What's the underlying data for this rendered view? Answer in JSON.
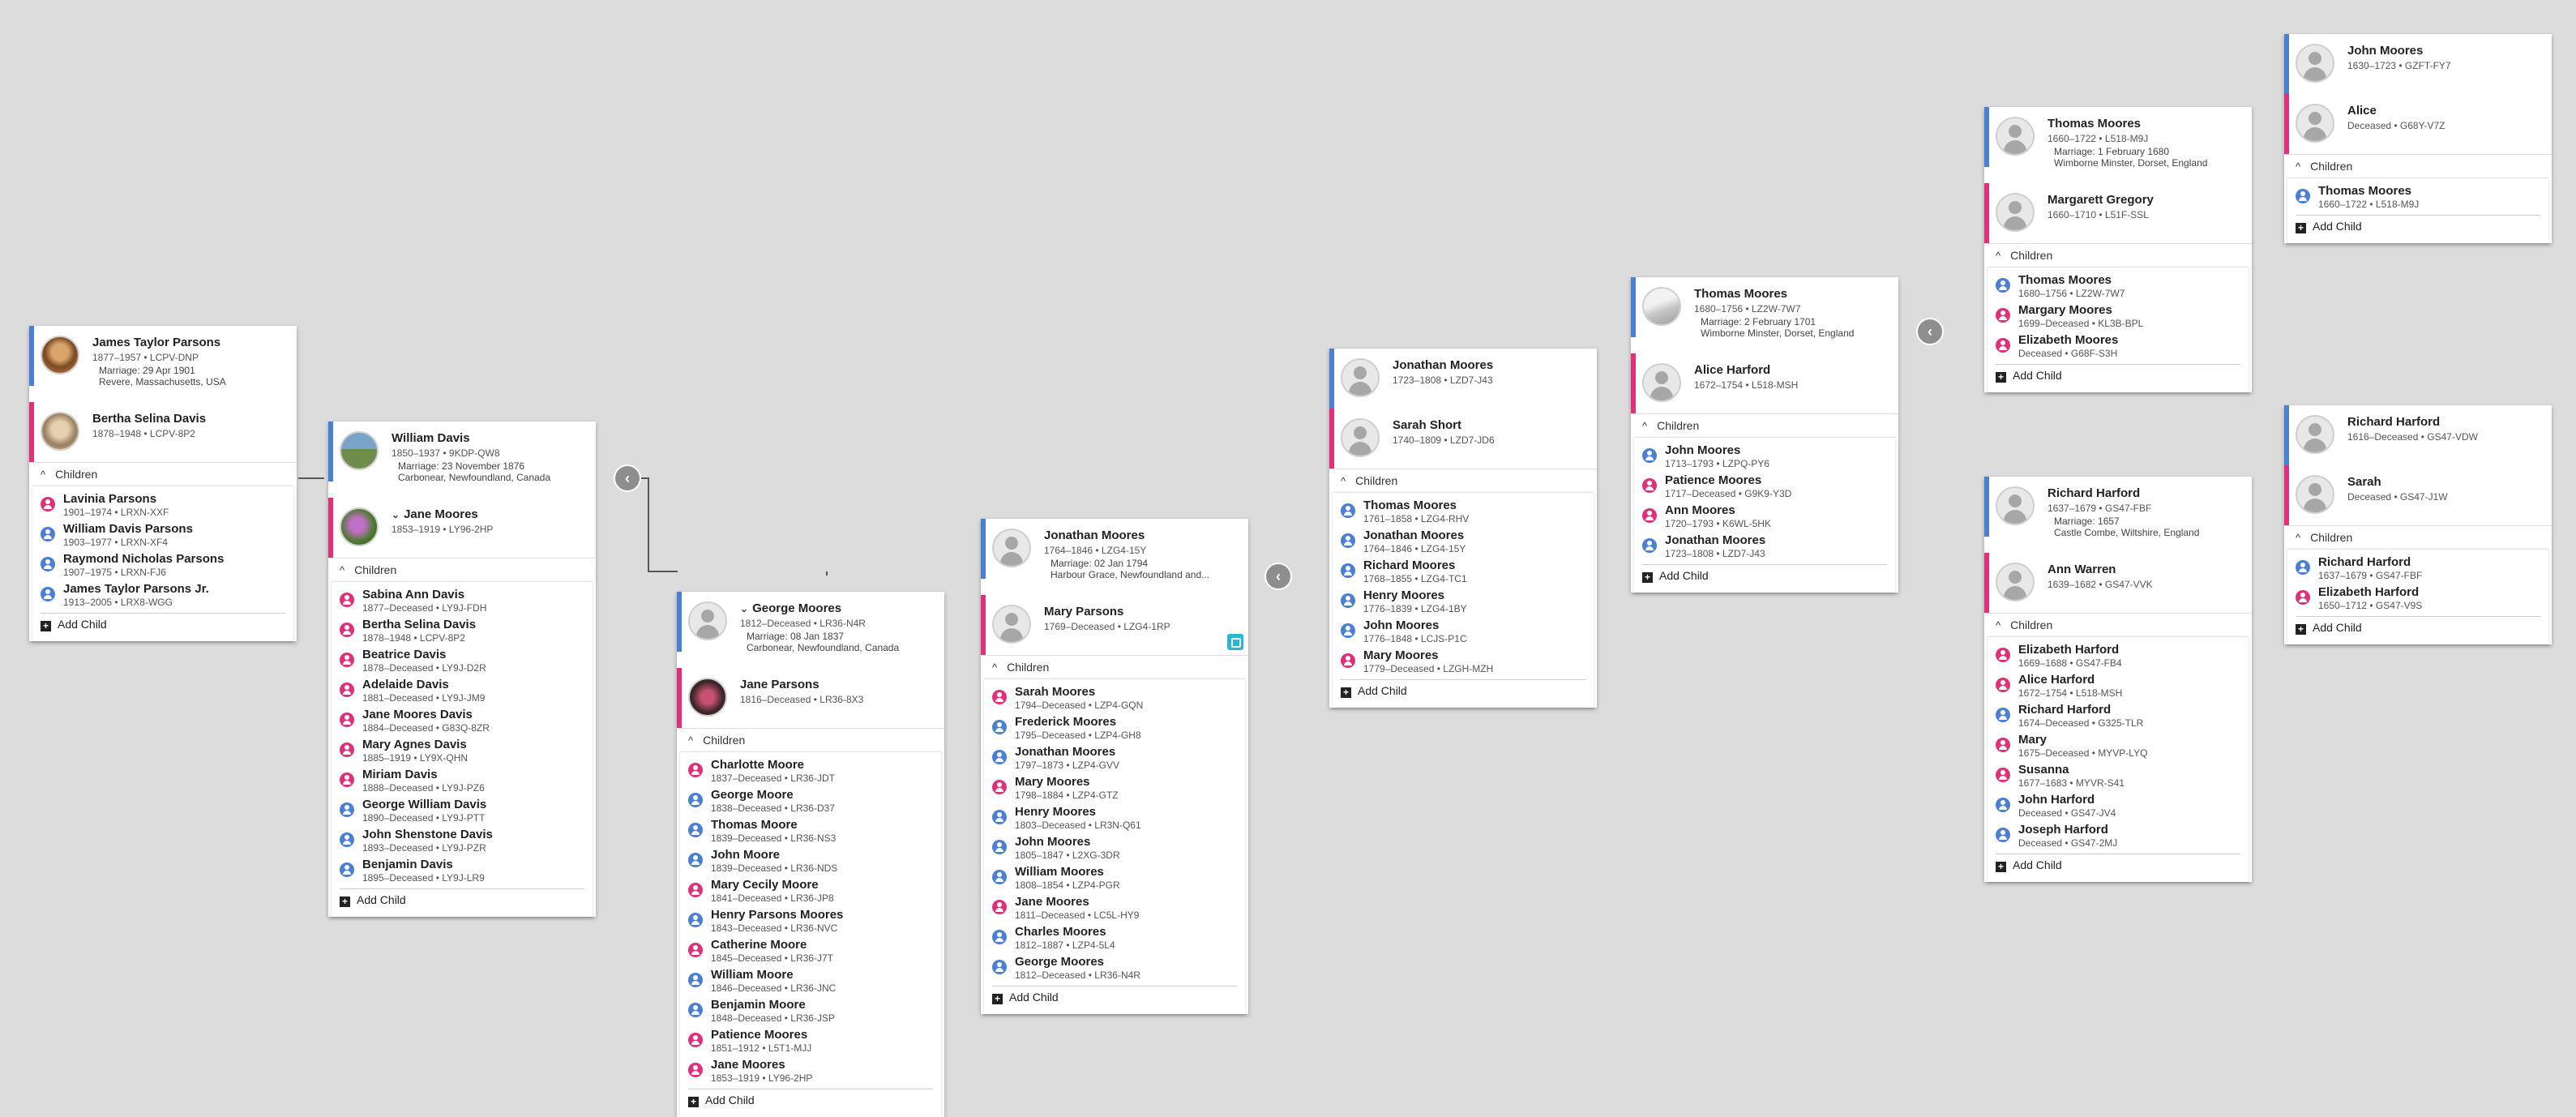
{
  "colors": {
    "male": "#4a7fd4",
    "female": "#e0307a",
    "background": "#dcdcdc"
  },
  "ui": {
    "children_label": "Children",
    "add_child_label": "Add Child",
    "collapse_glyph": "‹",
    "expand_chevron": "⌄",
    "up_chevron": "^"
  },
  "families": [
    {
      "id": "jamestaylor",
      "husband": {
        "name": "James Taylor Parsons",
        "dates": "1877–1957 • LCPV-DNP",
        "sex": "m",
        "photo": "ph-a"
      },
      "wife": {
        "name": "Bertha Selina Davis",
        "dates": "1878–1948 • LCPV-8P2",
        "sex": "f",
        "photo": "ph-b"
      },
      "marriage": [
        "Marriage: 29 Apr 1901",
        "Revere, Massachusetts, USA"
      ],
      "children": [
        {
          "name": "Lavinia Parsons",
          "dates": "1901–1974 • LRXN-XXF",
          "sex": "f"
        },
        {
          "name": "William Davis Parsons",
          "dates": "1903–1977 • LRXN-XF4",
          "sex": "m"
        },
        {
          "name": "Raymond Nicholas Parsons",
          "dates": "1907–1975 • LRXN-FJ6",
          "sex": "m"
        },
        {
          "name": "James Taylor Parsons Jr.",
          "dates": "1913–2005 • LRX8-WGG",
          "sex": "m"
        }
      ]
    },
    {
      "id": "williamdavis",
      "husband": {
        "name": "William Davis",
        "dates": "1850–1937 • 9KDP-QW8",
        "sex": "m",
        "photo": "ph-c"
      },
      "wife": {
        "name": "Jane Moores",
        "dates": "1853–1919 • LY96-2HP",
        "sex": "f",
        "photo": "ph-d",
        "expandable": true
      },
      "marriage": [
        "Marriage: 23 November 1876",
        "Carbonear, Newfoundland, Canada"
      ],
      "children": [
        {
          "name": "Sabina Ann Davis",
          "dates": "1877–Deceased • LY9J-FDH",
          "sex": "f"
        },
        {
          "name": "Bertha Selina Davis",
          "dates": "1878–1948 • LCPV-8P2",
          "sex": "f"
        },
        {
          "name": "Beatrice Davis",
          "dates": "1878–Deceased • LY9J-D2R",
          "sex": "f"
        },
        {
          "name": "Adelaide Davis",
          "dates": "1881–Deceased • LY9J-JM9",
          "sex": "f"
        },
        {
          "name": "Jane Moores Davis",
          "dates": "1884–Deceased • G83Q-8ZR",
          "sex": "f"
        },
        {
          "name": "Mary Agnes Davis",
          "dates": "1885–1919 • LY9X-QHN",
          "sex": "f"
        },
        {
          "name": "Miriam Davis",
          "dates": "1888–Deceased • LY9J-PZ6",
          "sex": "f"
        },
        {
          "name": "George William Davis",
          "dates": "1890–Deceased • LY9J-PTT",
          "sex": "m"
        },
        {
          "name": "John Shenstone Davis",
          "dates": "1893–Deceased • LY9J-PZR",
          "sex": "m"
        },
        {
          "name": "Benjamin Davis",
          "dates": "1895–Deceased • LY9J-LR9",
          "sex": "m"
        }
      ]
    },
    {
      "id": "georgemoores",
      "husband": {
        "name": "George Moores",
        "dates": "1812–Deceased • LR36-N4R",
        "sex": "m",
        "photo": "",
        "expandable": true
      },
      "wife": {
        "name": "Jane Parsons",
        "dates": "1816–Deceased • LR36-8X3",
        "sex": "f",
        "photo": "ph-e"
      },
      "marriage": [
        "Marriage: 08 Jan 1837",
        "Carbonear, Newfoundland, Canada"
      ],
      "children": [
        {
          "name": "Charlotte Moore",
          "dates": "1837–Deceased • LR36-JDT",
          "sex": "f"
        },
        {
          "name": "George Moore",
          "dates": "1838–Deceased • LR36-D37",
          "sex": "m"
        },
        {
          "name": "Thomas Moore",
          "dates": "1839–Deceased • LR36-NS3",
          "sex": "m"
        },
        {
          "name": "John Moore",
          "dates": "1839–Deceased • LR36-NDS",
          "sex": "m"
        },
        {
          "name": "Mary Cecily Moore",
          "dates": "1841–Deceased • LR36-JP8",
          "sex": "f"
        },
        {
          "name": "Henry Parsons Moores",
          "dates": "1843–Deceased • LR36-NVC",
          "sex": "m"
        },
        {
          "name": "Catherine Moore",
          "dates": "1845–Deceased • LR36-J7T",
          "sex": "f"
        },
        {
          "name": "William Moore",
          "dates": "1846–Deceased • LR36-JNC",
          "sex": "m"
        },
        {
          "name": "Benjamin Moore",
          "dates": "1848–Deceased • LR36-JSP",
          "sex": "m"
        },
        {
          "name": "Patience Moores",
          "dates": "1851–1912 • L5T1-MJJ",
          "sex": "f"
        },
        {
          "name": "Jane Moores",
          "dates": "1853–1919 • LY96-2HP",
          "sex": "f"
        }
      ]
    },
    {
      "id": "jonathan1764",
      "husband": {
        "name": "Jonathan Moores",
        "dates": "1764–1846 • LZG4-15Y",
        "sex": "m",
        "photo": ""
      },
      "wife": {
        "name": "Mary Parsons",
        "dates": "1769–Deceased • LZG4-1RP",
        "sex": "f",
        "photo": ""
      },
      "marriage": [
        "Marriage: 02 Jan 1794",
        "Harbour Grace, Newfoundland and..."
      ],
      "children": [
        {
          "name": "Sarah Moores",
          "dates": "1794–Deceased • LZP4-GQN",
          "sex": "f"
        },
        {
          "name": "Frederick Moores",
          "dates": "1795–Deceased • LZP4-GH8",
          "sex": "m"
        },
        {
          "name": "Jonathan Moores",
          "dates": "1797–1873 • LZP4-GVV",
          "sex": "m"
        },
        {
          "name": "Mary Moores",
          "dates": "1798–1884 • LZP4-GTZ",
          "sex": "f"
        },
        {
          "name": "Henry Moores",
          "dates": "1803–Deceased • LR3N-Q61",
          "sex": "m"
        },
        {
          "name": "John Moores",
          "dates": "1805–1847 • L2XG-3DR",
          "sex": "m"
        },
        {
          "name": "William Moores",
          "dates": "1808–1854 • LZP4-PGR",
          "sex": "m"
        },
        {
          "name": "Jane Moores",
          "dates": "1811–Deceased • LC5L-HY9",
          "sex": "f"
        },
        {
          "name": "Charles Moores",
          "dates": "1812–1887 • LZP4-5L4",
          "sex": "m"
        },
        {
          "name": "George Moores",
          "dates": "1812–Deceased • LR36-N4R",
          "sex": "m"
        }
      ]
    },
    {
      "id": "jonathan1723",
      "husband": {
        "name": "Jonathan Moores",
        "dates": "1723–1808 • LZD7-J43",
        "sex": "m",
        "photo": ""
      },
      "wife": {
        "name": "Sarah Short",
        "dates": "1740–1809 • LZD7-JD6",
        "sex": "f",
        "photo": ""
      },
      "marriage": [],
      "children": [
        {
          "name": "Thomas Moores",
          "dates": "1761–1858 • LZG4-RHV",
          "sex": "m"
        },
        {
          "name": "Jonathan Moores",
          "dates": "1764–1846 • LZG4-15Y",
          "sex": "m"
        },
        {
          "name": "Richard Moores",
          "dates": "1768–1855 • LZG4-TC1",
          "sex": "m"
        },
        {
          "name": "Henry Moores",
          "dates": "1776–1839 • LZG4-1BY",
          "sex": "m"
        },
        {
          "name": "John Moores",
          "dates": "1776–1848 • LCJS-P1C",
          "sex": "m"
        },
        {
          "name": "Mary Moores",
          "dates": "1779–Deceased • LZGH-MZH",
          "sex": "f"
        }
      ]
    },
    {
      "id": "thomas1680",
      "husband": {
        "name": "Thomas Moores",
        "dates": "1680–1756 • LZ2W-7W7",
        "sex": "m",
        "photo": "ph-f"
      },
      "wife": {
        "name": "Alice Harford",
        "dates": "1672–1754 • L518-MSH",
        "sex": "f",
        "photo": ""
      },
      "marriage": [
        "Marriage: 2 February 1701",
        "Wimborne Minster, Dorset, England"
      ],
      "children": [
        {
          "name": "John Moores",
          "dates": "1713–1793 • LZPQ-PY6",
          "sex": "m"
        },
        {
          "name": "Patience Moores",
          "dates": "1717–Deceased • G9K9-Y3D",
          "sex": "f"
        },
        {
          "name": "Ann Moores",
          "dates": "1720–1793 • K6WL-5HK",
          "sex": "f"
        },
        {
          "name": "Jonathan Moores",
          "dates": "1723–1808 • LZD7-J43",
          "sex": "m"
        }
      ]
    },
    {
      "id": "thomas1660",
      "husband": {
        "name": "Thomas Moores",
        "dates": "1660–1722 • L518-M9J",
        "sex": "m",
        "photo": ""
      },
      "wife": {
        "name": "Margarett Gregory",
        "dates": "1660–1710 • L51F-SSL",
        "sex": "f",
        "photo": ""
      },
      "marriage": [
        "Marriage: 1 February 1680",
        "Wimborne Minster, Dorset, England"
      ],
      "children": [
        {
          "name": "Thomas Moores",
          "dates": "1680–1756 • LZ2W-7W7",
          "sex": "m"
        },
        {
          "name": "Margary Moores",
          "dates": "1699–Deceased • KL3B-BPL",
          "sex": "f"
        },
        {
          "name": "Elizabeth Moores",
          "dates": "Deceased • G68F-S3H",
          "sex": "f"
        }
      ]
    },
    {
      "id": "richard1637",
      "husband": {
        "name": "Richard Harford",
        "dates": "1637–1679 • GS47-FBF",
        "sex": "m",
        "photo": ""
      },
      "wife": {
        "name": "Ann Warren",
        "dates": "1639–1682 • GS47-VVK",
        "sex": "f",
        "photo": ""
      },
      "marriage": [
        "Marriage: 1657",
        "Castle Combe, Wiltshire, England"
      ],
      "children": [
        {
          "name": "Elizabeth Harford",
          "dates": "1669–1688 • GS47-FB4",
          "sex": "f"
        },
        {
          "name": "Alice Harford",
          "dates": "1672–1754 • L518-MSH",
          "sex": "f"
        },
        {
          "name": "Richard Harford",
          "dates": "1674–Deceased • G325-TLR",
          "sex": "m"
        },
        {
          "name": "Mary",
          "dates": "1675–Deceased • MYVP-LYQ",
          "sex": "f"
        },
        {
          "name": "Susanna",
          "dates": "1677–1683 • MYVR-S41",
          "sex": "f"
        },
        {
          "name": "John Harford",
          "dates": "Deceased • GS47-JV4",
          "sex": "m"
        },
        {
          "name": "Joseph Harford",
          "dates": "Deceased • GS47-2MJ",
          "sex": "m"
        }
      ]
    },
    {
      "id": "john1630",
      "husband": {
        "name": "John Moores",
        "dates": "1630–1723 • GZFT-FY7",
        "sex": "m",
        "photo": ""
      },
      "wife": {
        "name": "Alice",
        "dates": "Deceased • G68Y-V7Z",
        "sex": "f",
        "photo": ""
      },
      "marriage": [],
      "children": [
        {
          "name": "Thomas Moores",
          "dates": "1660–1722 • L518-M9J",
          "sex": "m"
        }
      ]
    },
    {
      "id": "richard1616",
      "husband": {
        "name": "Richard Harford",
        "dates": "1616–Deceased • GS47-VDW",
        "sex": "m",
        "photo": ""
      },
      "wife": {
        "name": "Sarah",
        "dates": "Deceased • GS47-J1W",
        "sex": "f",
        "photo": ""
      },
      "marriage": [],
      "children": [
        {
          "name": "Richard Harford",
          "dates": "1637–1679 • GS47-FBF",
          "sex": "m"
        },
        {
          "name": "Elizabeth Harford",
          "dates": "1650–1712 • GS47-V9S",
          "sex": "f"
        }
      ]
    }
  ]
}
